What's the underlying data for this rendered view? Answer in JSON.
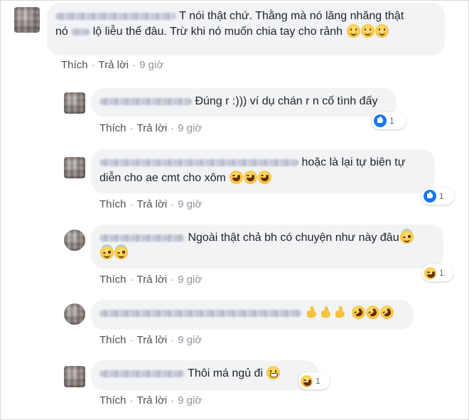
{
  "actions": {
    "like": "Thích",
    "reply": "Trả lời",
    "dot": "·"
  },
  "comments": [
    {
      "text_line1": "T nói thật chứ. Thằng mà nó lăng nhăng thật",
      "text_line2_a": "nó",
      "text_line2_b": "lộ liễu thế đâu. Trừ khi nó muốn chia tay cho rảnh",
      "emojis": [
        "smile",
        "smile",
        "smile"
      ],
      "time": "9 giờ"
    },
    {
      "text": "Đúng r :))) ví dụ chán r n cố tình đấy",
      "time": "9 giờ",
      "reaction": {
        "icon": "like-icon",
        "count": "1"
      }
    },
    {
      "text_line1": "hoặc là lại tự biên tự",
      "text_line2": "diễn cho ae cmt cho xôm",
      "emojis": [
        "laugh",
        "laugh",
        "laugh"
      ],
      "time": "9 giờ",
      "reaction": {
        "icon": "like-icon",
        "count": "1"
      }
    },
    {
      "text": "Ngoài thật chả bh có chuyện như này đâu",
      "emojis": [
        "halo",
        "halo",
        "halo"
      ],
      "time": "9 giờ",
      "reaction": {
        "icon": "laugh-icon",
        "count": "1"
      }
    },
    {
      "emojis": [
        "thumb",
        "thumb",
        "thumb",
        "rofl",
        "rofl",
        "rofl"
      ],
      "time": "9 giờ"
    },
    {
      "text": "Thôi má ngủ đi",
      "emojis": [
        "grin"
      ],
      "time": "9 giờ",
      "reaction": {
        "icon": "laugh-icon",
        "count": "1"
      }
    }
  ],
  "colors": {
    "bubble": "#f2f3f5",
    "action": "#4b4f56",
    "like_blue": "#1877f2"
  }
}
